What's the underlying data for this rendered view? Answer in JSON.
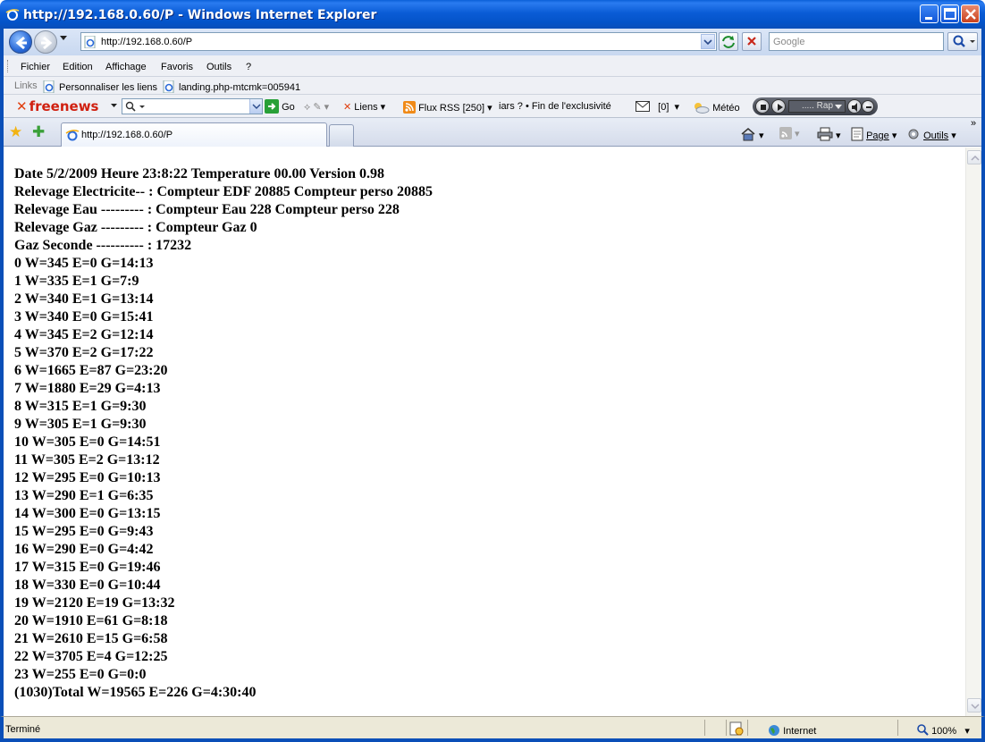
{
  "window": {
    "title": "http://192.168.0.60/P - Windows Internet Explorer"
  },
  "address": {
    "url": "http://192.168.0.60/P",
    "search_placeholder": "Google"
  },
  "menu": {
    "items": [
      "Fichier",
      "Edition",
      "Affichage",
      "Favoris",
      "Outils",
      "?"
    ]
  },
  "links": {
    "label": "Links",
    "items": [
      "Personnaliser les liens",
      "landing.php-mtcmk=005941"
    ]
  },
  "freenews": {
    "logo": "freenews",
    "go": "Go",
    "liens": "Liens",
    "rss": "Flux RSS [250]",
    "ticker": "iars ? • Fin de l'exclusivité",
    "mail_count": "[0]",
    "meteo": "Météo",
    "station": "..... Rap"
  },
  "tabs": {
    "active_tab": "http://192.168.0.60/P",
    "page_label": "Page",
    "tools_label": "Outils"
  },
  "page": {
    "lines": [
      "Date 5/2/2009 Heure 23:8:22 Temperature 00.00 Version 0.98",
      "Relevage Electricite-- : Compteur EDF 20885 Compteur perso 20885",
      "Relevage Eau --------- : Compteur Eau 228 Compteur perso 228",
      "Relevage Gaz --------- : Compteur Gaz 0",
      "Gaz Seconde ---------- : 17232",
      "0 W=345 E=0 G=14:13",
      "1 W=335 E=1 G=7:9",
      "2 W=340 E=1 G=13:14",
      "3 W=340 E=0 G=15:41",
      "4 W=345 E=2 G=12:14",
      "5 W=370 E=2 G=17:22",
      "6 W=1665 E=87 G=23:20",
      "7 W=1880 E=29 G=4:13",
      "8 W=315 E=1 G=9:30",
      "9 W=305 E=1 G=9:30",
      "10 W=305 E=0 G=14:51",
      "11 W=305 E=2 G=13:12",
      "12 W=295 E=0 G=10:13",
      "13 W=290 E=1 G=6:35",
      "14 W=300 E=0 G=13:15",
      "15 W=295 E=0 G=9:43",
      "16 W=290 E=0 G=4:42",
      "17 W=315 E=0 G=19:46",
      "18 W=330 E=0 G=10:44",
      "19 W=2120 E=19 G=13:32",
      "20 W=1910 E=61 G=8:18",
      "21 W=2610 E=15 G=6:58",
      "22 W=3705 E=4 G=12:25",
      "23 W=255 E=0 G=0:0",
      "(1030)Total W=19565 E=226 G=4:30:40"
    ]
  },
  "status": {
    "text": "Terminé",
    "zone": "Internet",
    "zoom": "100%"
  },
  "colors": {
    "titlebar": "#0a5cd6",
    "accent_red": "#d02010"
  }
}
